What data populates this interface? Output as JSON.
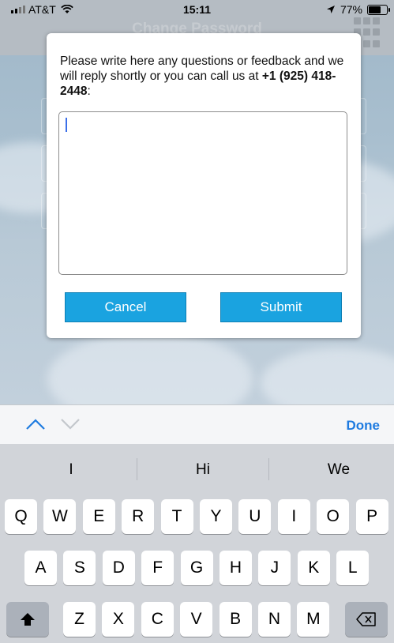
{
  "status_bar": {
    "carrier": "AT&T",
    "time": "15:11",
    "battery": "77%",
    "battery_level": 0.77
  },
  "background": {
    "title": "Change Password"
  },
  "dialog": {
    "message_pre": "Please write here any questions or feedback and we will reply shortly or you can call us at ",
    "phone": "+1 (925) 418-2448",
    "message_post": ":",
    "textarea_value": "",
    "cancel_label": "Cancel",
    "submit_label": "Submit"
  },
  "accessory": {
    "done_label": "Done"
  },
  "keyboard": {
    "suggestions": [
      "I",
      "Hi",
      "We"
    ],
    "row1": [
      "Q",
      "W",
      "E",
      "R",
      "T",
      "Y",
      "U",
      "I",
      "O",
      "P"
    ],
    "row2": [
      "A",
      "S",
      "D",
      "F",
      "G",
      "H",
      "J",
      "K",
      "L"
    ],
    "row3": [
      "Z",
      "X",
      "C",
      "V",
      "B",
      "N",
      "M"
    ]
  },
  "colors": {
    "accent": "#1aa3e0",
    "done": "#1e7be0"
  }
}
